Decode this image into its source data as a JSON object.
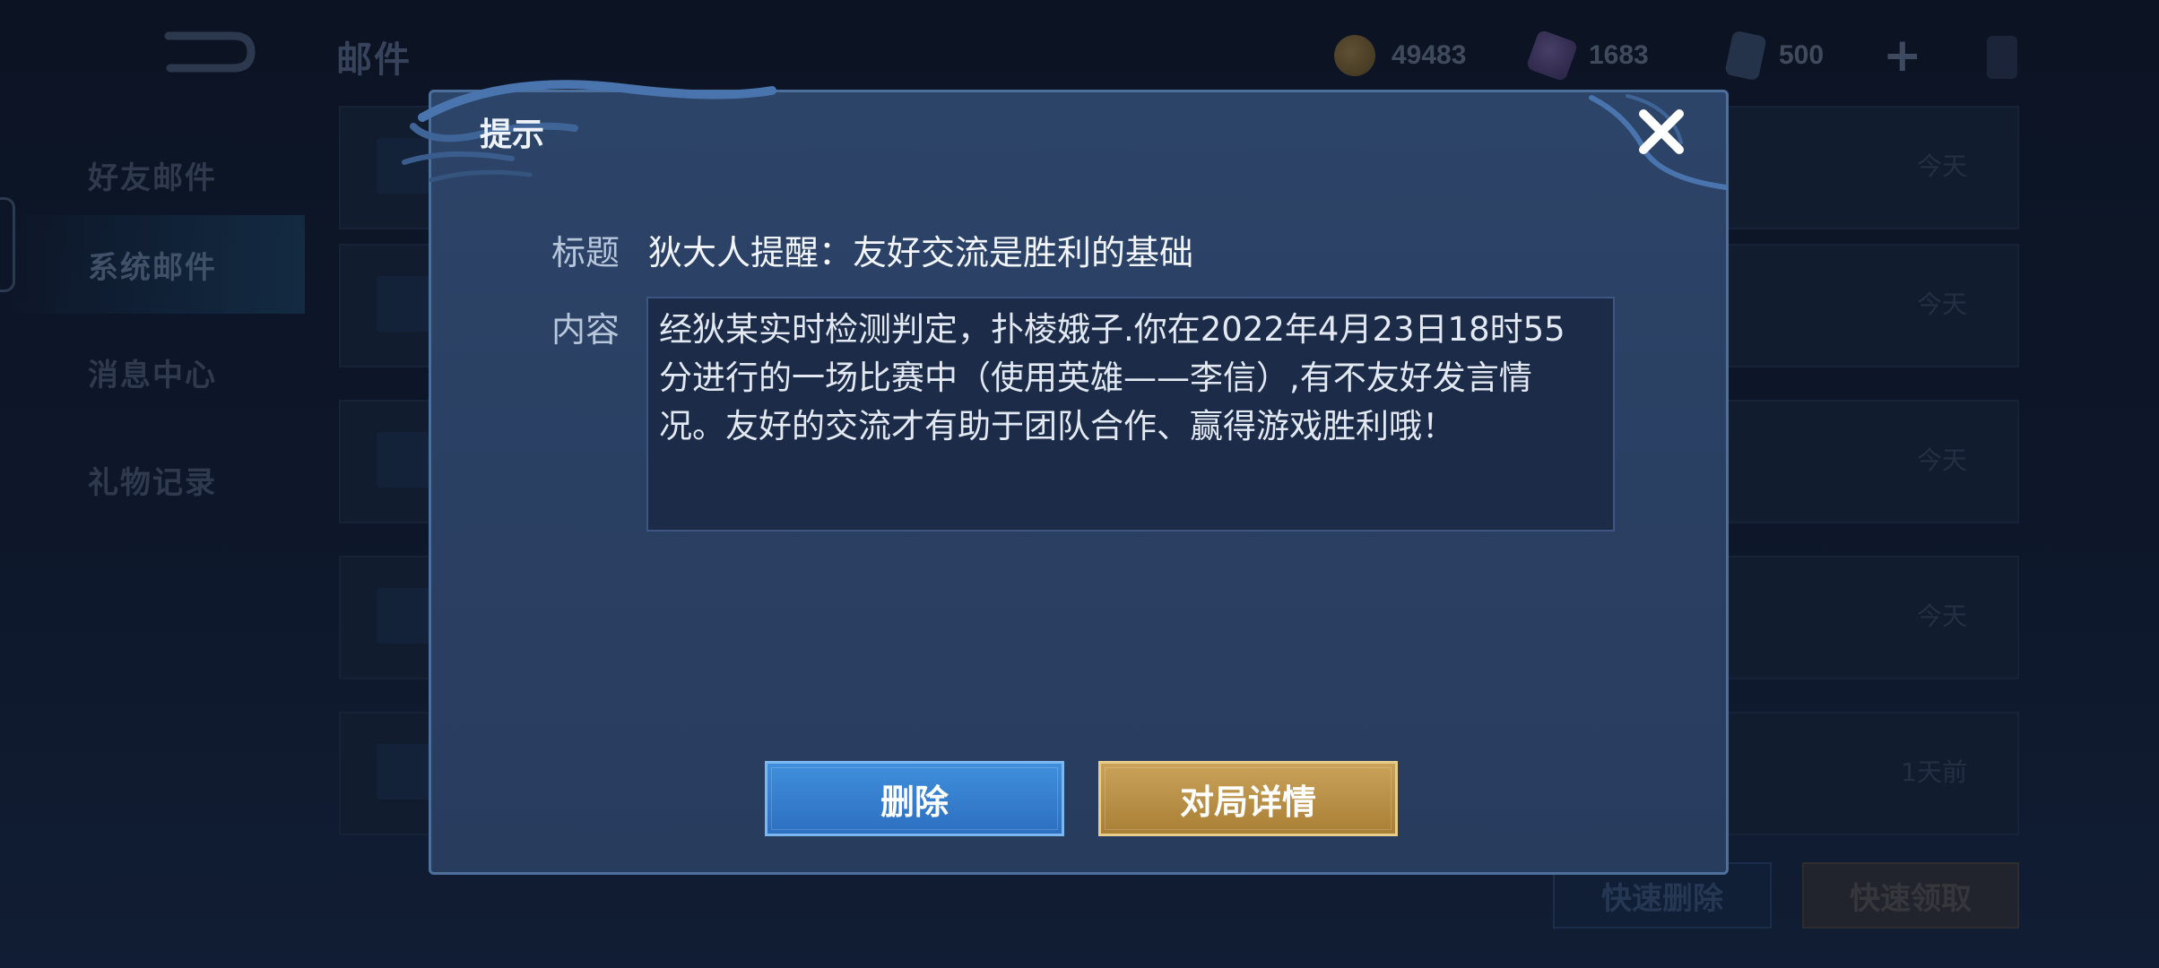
{
  "header": {
    "title": "邮件",
    "resources": {
      "gold": "49483",
      "gems": "1683",
      "tickets": "500"
    },
    "icons": [
      "back-icon",
      "gold-coin-icon",
      "gem-icon",
      "ticket-icon",
      "plus-icon",
      "energy-icon"
    ]
  },
  "sidebar": {
    "items": [
      {
        "label": "好友邮件"
      },
      {
        "label": "系统邮件"
      },
      {
        "label": "消息中心"
      },
      {
        "label": "礼物记录"
      }
    ],
    "active": "系统邮件"
  },
  "mail_list": {
    "rows": [
      {
        "time": "今天"
      },
      {
        "time": "今天"
      },
      {
        "time": "今天"
      },
      {
        "time": "今天"
      },
      {
        "time": "1天前"
      }
    ],
    "quick_delete_label": "快速删除",
    "quick_claim_label": "快速领取"
  },
  "dialog": {
    "title": "提示",
    "subject_label": "标题",
    "subject": "狄大人提醒：友好交流是胜利的基础",
    "content_label": "内容",
    "content_lines": [
      "经狄某实时检测判定，扑棱娥子.你在2022年4月23日18时55",
      "分进行的一场比赛中（使用英雄——李信）,有不友好发言情",
      "况。友好的交流才有助于团队合作、赢得游戏胜利哦！"
    ],
    "delete_label": "删除",
    "details_label": "对局详情"
  },
  "colors": {
    "delete_button": "#3f8fdc",
    "details_button": "#caa259",
    "dialog_bg": "#2c4468"
  }
}
